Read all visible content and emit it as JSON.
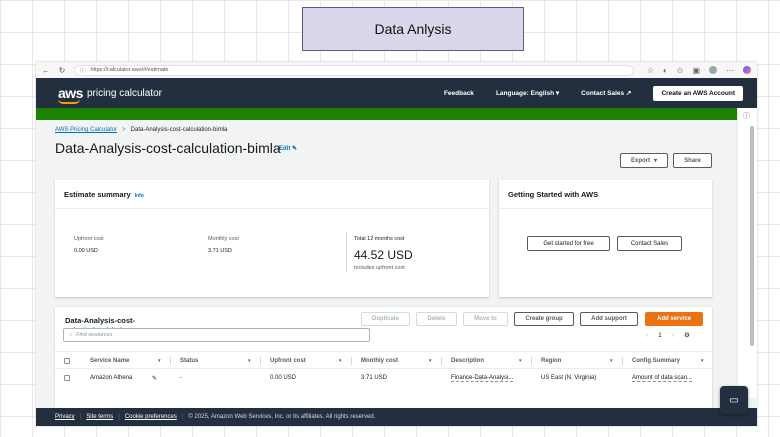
{
  "slide": {
    "title": "Data Anlysis"
  },
  "browser": {
    "url": "https://calculator.aws/#/estimate",
    "back_icon": "arrow-left-icon",
    "reload_icon": "reload-icon"
  },
  "aws_header": {
    "logo": "aws",
    "product": "pricing calculator",
    "feedback": "Feedback",
    "language": "Language: English",
    "contact_sales": "Contact Sales",
    "create_account": "Create an AWS Account"
  },
  "breadcrumb": {
    "root": "AWS Pricing Calculator",
    "current": "Data-Analysis-cost-calculation-bimla"
  },
  "page": {
    "title": "Data-Analysis-cost-calculation-bimla",
    "edit": "Edit",
    "export": "Export",
    "share": "Share"
  },
  "estimate_summary": {
    "title": "Estimate summary",
    "info": "Info",
    "upfront_label": "Upfront cost",
    "upfront_value": "0.00 USD",
    "monthly_label": "Monthly cost",
    "monthly_value": "3.71 USD",
    "total_label": "Total 12 months cost",
    "total_value": "44.52 USD",
    "total_note": "Includes upfront cost"
  },
  "getting_started": {
    "title": "Getting Started with AWS",
    "free_button": "Get started for free",
    "contact_button": "Contact Sales"
  },
  "services": {
    "title_line1": "Data-Analysis-cost-",
    "title_line2": "calculation-bimla",
    "duplicate": "Duplicate",
    "delete": "Delete",
    "move_to": "Move to",
    "create_group": "Create group",
    "add_support": "Add support",
    "add_service": "Add service",
    "search_placeholder": "Find resources",
    "page": "1",
    "columns": [
      "Service Name",
      "Status",
      "Upfront cost",
      "Monthly cost",
      "Description",
      "Region",
      "Config Summary"
    ],
    "rows": [
      {
        "service": "Amazon Athena",
        "status": "-",
        "upfront": "0.00 USD",
        "monthly": "3.71 USD",
        "description": "Finance-Data-Analysi...",
        "region": "US East (N. Virginia)",
        "config": "Amount of data scan..."
      }
    ]
  },
  "footer": {
    "privacy": "Privacy",
    "site_terms": "Site terms",
    "cookie": "Cookie preferences",
    "copyright": "© 2025, Amazon Web Services, Inc. or its affiliates. All rights reserved."
  },
  "colors": {
    "aws_navy": "#232f3e",
    "aws_orange": "#ec7211",
    "banner_green": "#1d8102",
    "link_blue": "#0073bb"
  }
}
